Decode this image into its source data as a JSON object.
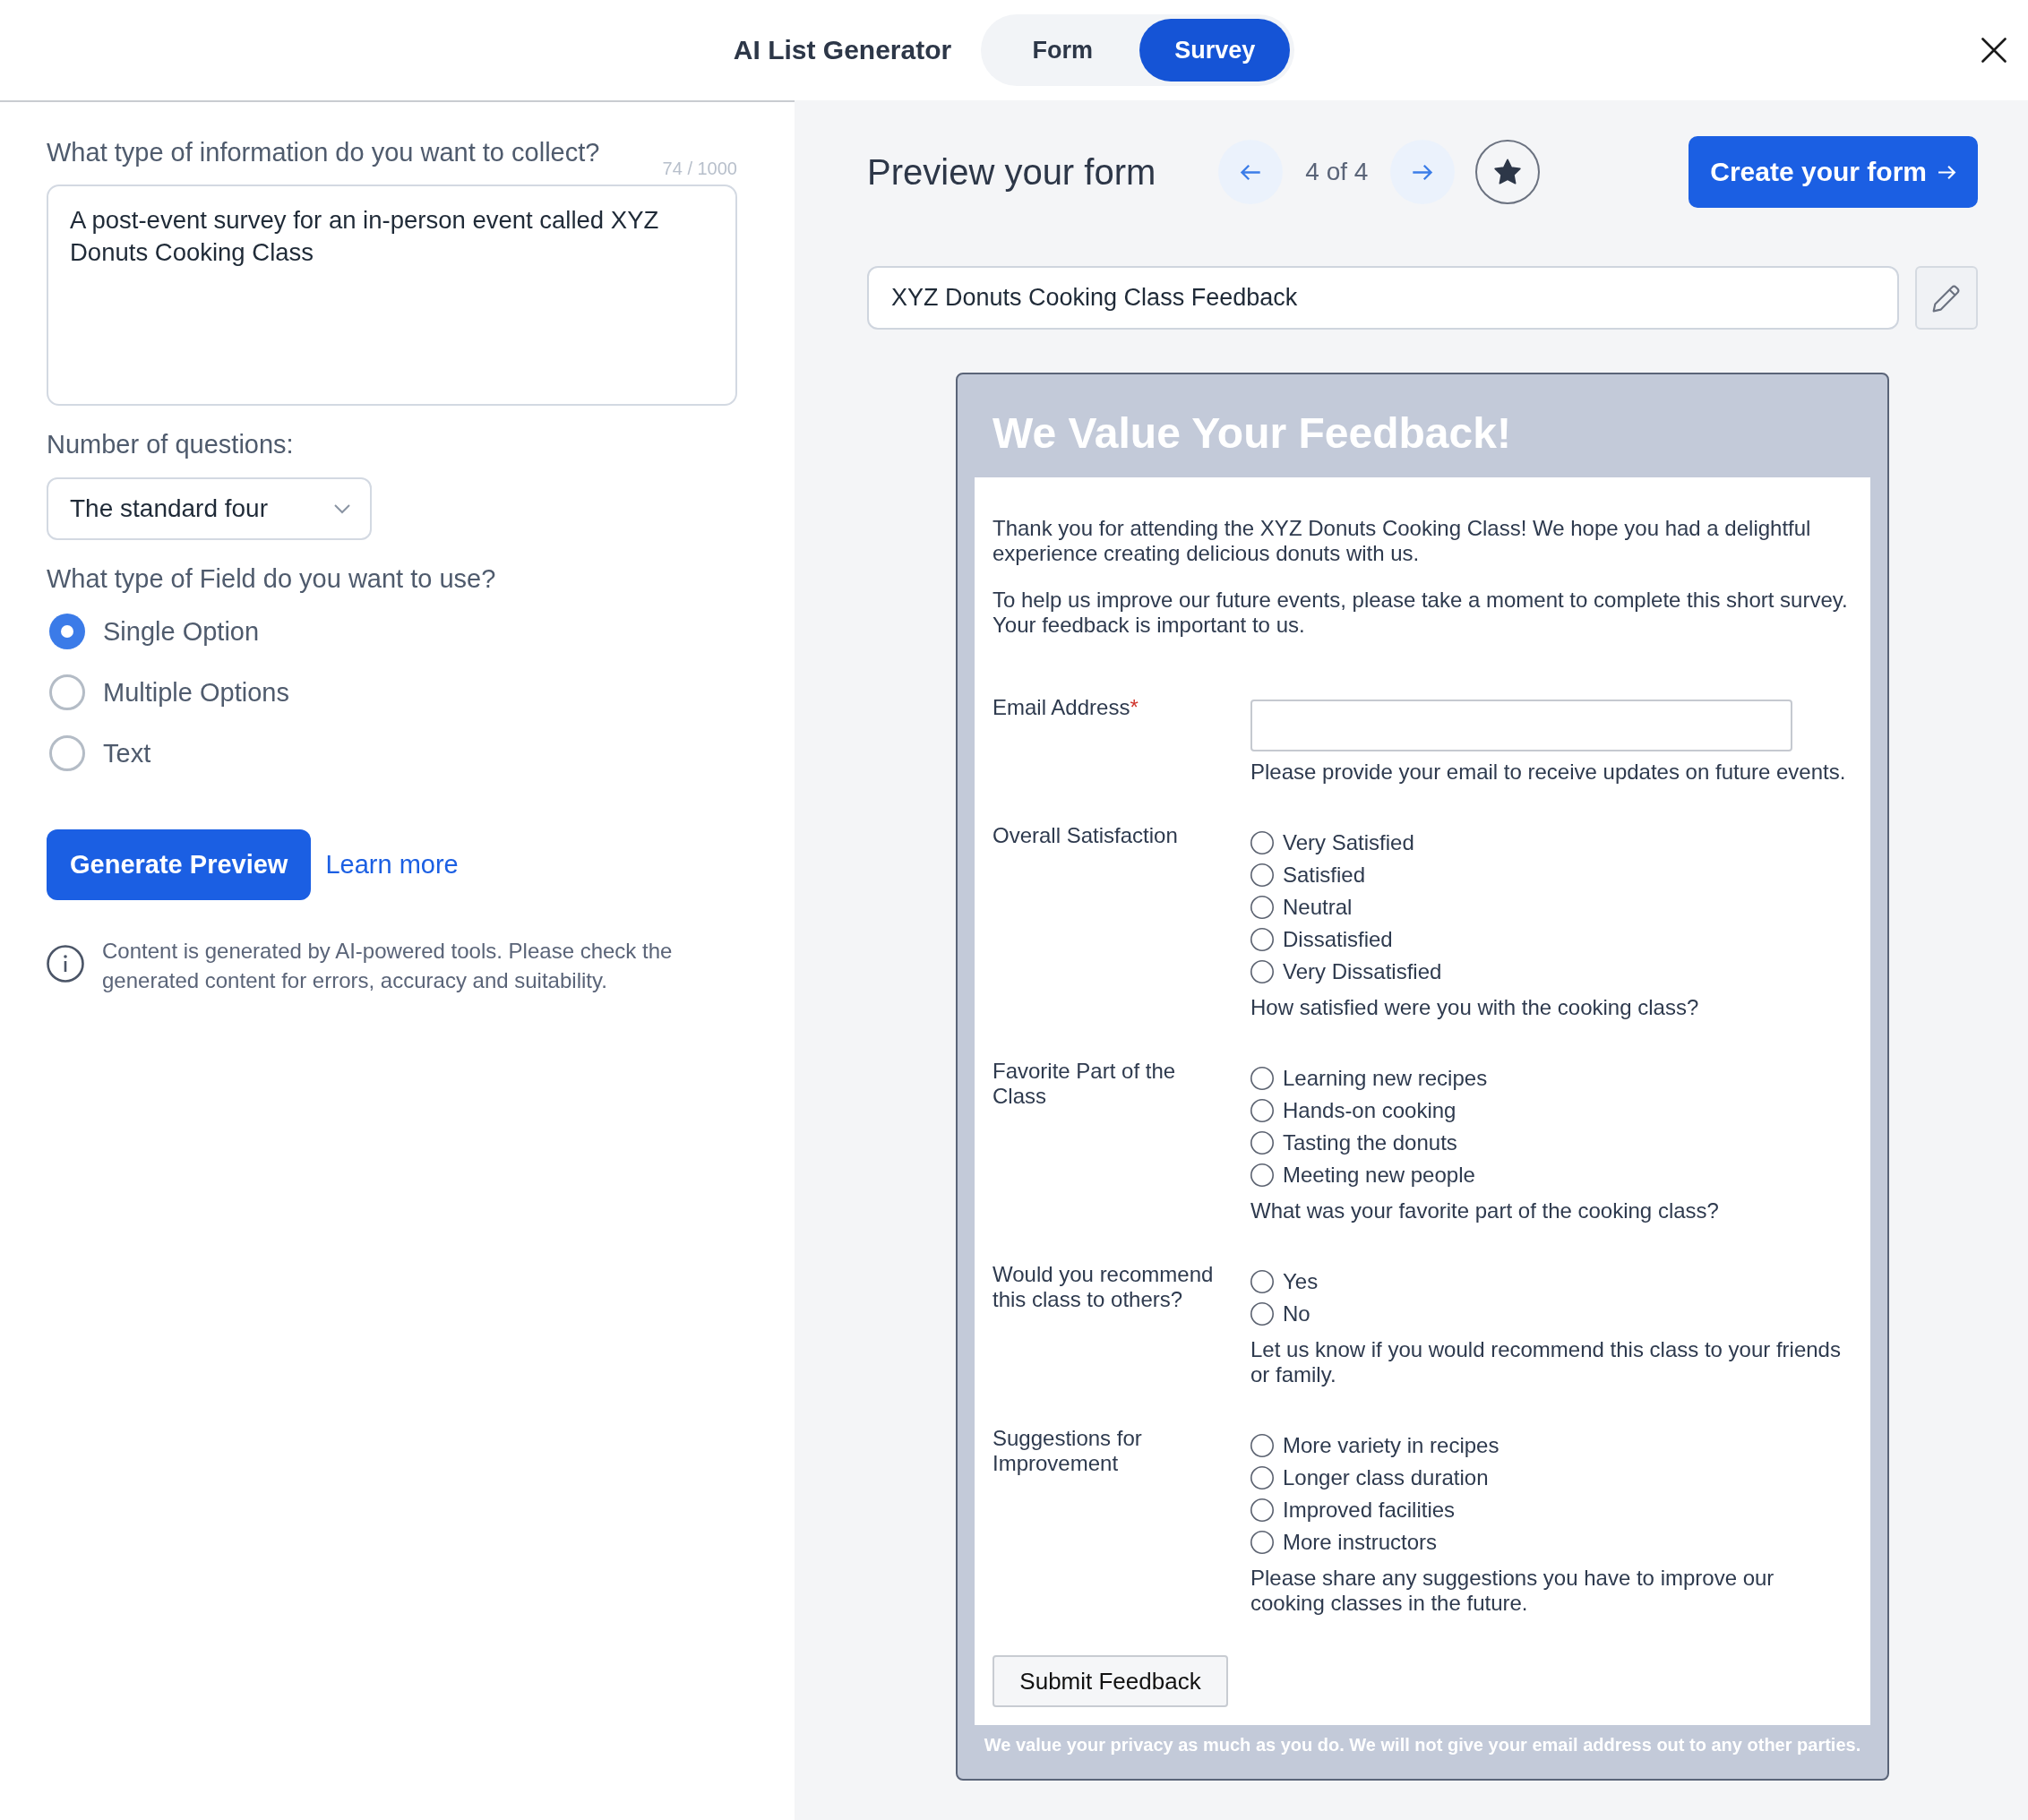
{
  "header": {
    "title": "AI List Generator",
    "mode_tabs": [
      {
        "label": "Form",
        "selected": false
      },
      {
        "label": "Survey",
        "selected": true
      }
    ]
  },
  "generator": {
    "description": {
      "label": "What type of information do you want to collect?",
      "counter": "74 / 1000",
      "value": "A post-event survey for an in-person event called XYZ Donuts Cooking Class"
    },
    "question_count": {
      "label": "Number of questions:",
      "value": "The standard four"
    },
    "field_type": {
      "label": "What type of Field do you want to use?",
      "options": [
        {
          "label": "Single Option",
          "selected": true
        },
        {
          "label": "Multiple Options",
          "selected": false
        },
        {
          "label": "Text",
          "selected": false
        }
      ]
    },
    "generate_button": "Generate Preview",
    "learn_more_link": "Learn more",
    "disclaimer": "Content is generated by AI-powered tools. Please check the generated content for errors, accuracy and suitability."
  },
  "preview": {
    "heading": "Preview your form",
    "pager": "4 of 4",
    "create_button": "Create your form",
    "form_title": "XYZ Donuts Cooking Class Feedback",
    "form": {
      "title": "We Value Your Feedback!",
      "intro": [
        "Thank you for attending the XYZ Donuts Cooking Class! We hope you had a delightful experience creating delicious donuts with us.",
        "To help us improve our future events, please take a moment to complete this short survey. Your feedback is important to us."
      ],
      "fields": [
        {
          "kind": "email",
          "label": "Email Address",
          "required_mark": "*",
          "help": "Please provide your email to receive updates on future events."
        },
        {
          "kind": "radio",
          "label": "Overall Satisfaction",
          "options": [
            {
              "label": "Very Satisfied",
              "selected": false
            },
            {
              "label": "Satisfied",
              "selected": false
            },
            {
              "label": "Neutral",
              "selected": false
            },
            {
              "label": "Dissatisfied",
              "selected": false
            },
            {
              "label": "Very Dissatisfied",
              "selected": false
            }
          ],
          "help": "How satisfied were you with the cooking class?"
        },
        {
          "kind": "radio",
          "label": "Favorite Part of the Class",
          "options": [
            {
              "label": "Learning new recipes",
              "selected": false
            },
            {
              "label": "Hands-on cooking",
              "selected": false
            },
            {
              "label": "Tasting the donuts",
              "selected": false
            },
            {
              "label": "Meeting new people",
              "selected": false
            }
          ],
          "help": "What was your favorite part of the cooking class?"
        },
        {
          "kind": "radio",
          "label": "Would you recommend this class to others?",
          "options": [
            {
              "label": "Yes",
              "selected": false
            },
            {
              "label": "No",
              "selected": false
            }
          ],
          "help": "Let us know if you would recommend this class to your friends or family."
        },
        {
          "kind": "radio",
          "label": "Suggestions for Improvement",
          "options": [
            {
              "label": "More variety in recipes",
              "selected": false
            },
            {
              "label": "Longer class duration",
              "selected": false
            },
            {
              "label": "Improved facilities",
              "selected": false
            },
            {
              "label": "More instructors",
              "selected": false
            }
          ],
          "help": "Please share any suggestions you have to improve our cooking classes in the future."
        }
      ],
      "submit_button": "Submit Feedback",
      "footer": "We value your privacy as much as you do. We will not give your email address out to any other parties."
    }
  }
}
